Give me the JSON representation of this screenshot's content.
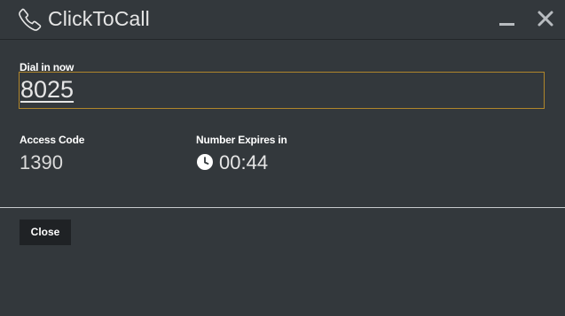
{
  "window": {
    "title": "ClickToCall",
    "title_icon": "phone-icon",
    "minimize_icon": "minimize-icon",
    "close_icon": "close-icon"
  },
  "dial": {
    "label": "Dial in now",
    "number": "8025"
  },
  "access": {
    "label": "Access Code",
    "value": "1390"
  },
  "expires": {
    "label": "Number Expires in",
    "icon": "clock-icon",
    "value": "00:44"
  },
  "footer": {
    "close_label": "Close"
  },
  "colors": {
    "background": "#33383c",
    "field_border": "#b0862b",
    "button_bg": "#1f2225"
  }
}
